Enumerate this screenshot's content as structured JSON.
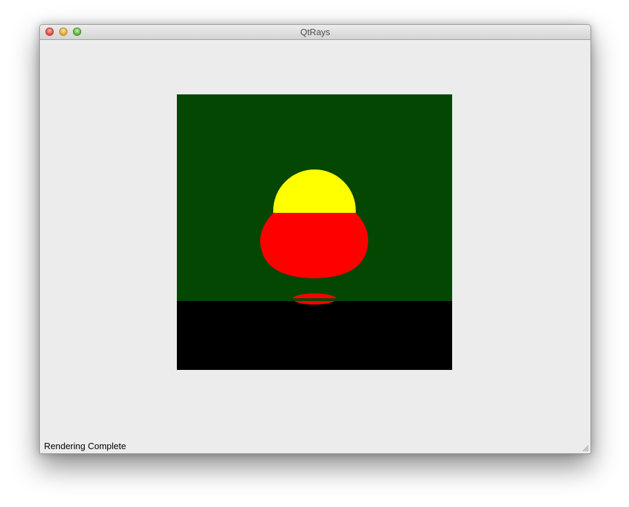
{
  "window": {
    "title": "QtRays",
    "buttons": [
      "close",
      "minimize",
      "zoom"
    ]
  },
  "render": {
    "icon_names": [
      "sky",
      "floor",
      "yellow-sphere",
      "red-sphere",
      "red-sphere-reflection"
    ],
    "colors": {
      "sky": "#034703",
      "floor": "#000000",
      "yellow_sphere": "#ffff00",
      "red_sphere": "#ff0000"
    }
  },
  "status_bar": {
    "text": "Rendering Complete"
  }
}
